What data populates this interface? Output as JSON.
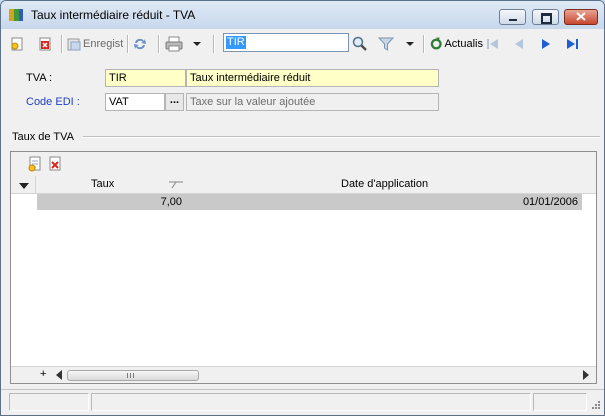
{
  "window": {
    "title": "Taux intermédiaire réduit -  TVA"
  },
  "toolbar": {
    "save_label": "Enregist",
    "search_value": "TIR",
    "refresh_label": "Actualis"
  },
  "form": {
    "tva_label": "TVA :",
    "tva_code": "TIR",
    "tva_name": "Taux intermédiaire réduit",
    "edi_label": "Code EDI :",
    "edi_code": "VAT",
    "edi_button": "...",
    "edi_description": "Taxe sur la valeur ajoutée"
  },
  "group": {
    "title": "Taux de TVA"
  },
  "grid": {
    "columns": [
      "Taux",
      "Date d'application"
    ],
    "rows": [
      {
        "taux": "7,00",
        "date": "01/01/2006"
      }
    ],
    "add_label": "+"
  },
  "colors": {
    "accent": "#3399ff",
    "field_yellow": "#ffffc8",
    "link_blue": "#1f3fbf",
    "selected_row": "#c9c9c9"
  }
}
